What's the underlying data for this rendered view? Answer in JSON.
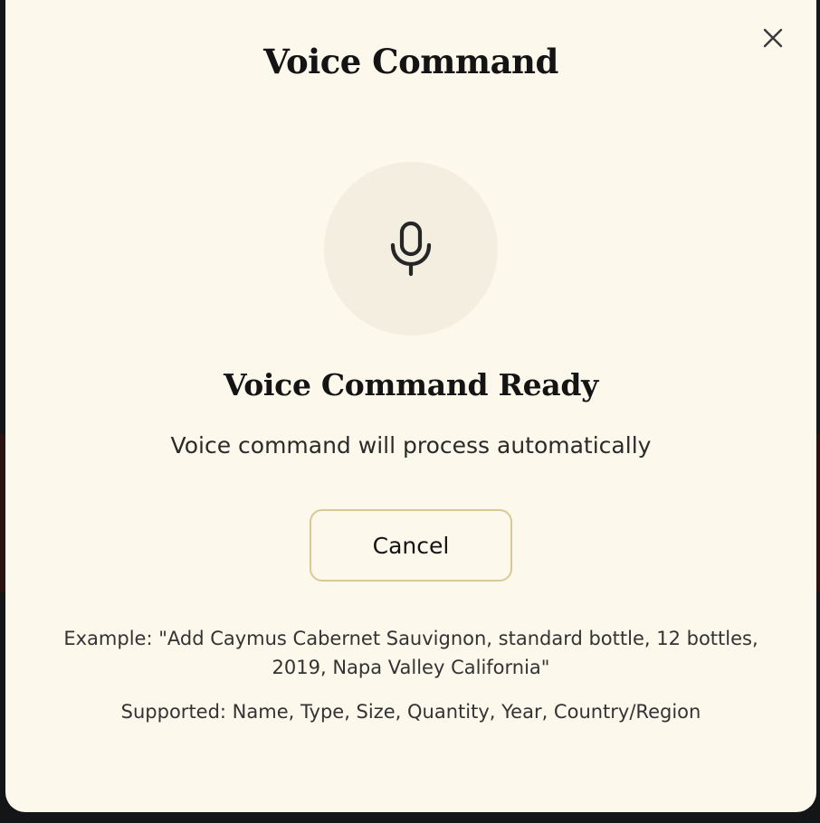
{
  "modal": {
    "title": "Voice Command",
    "close_icon": "close-icon",
    "mic_icon": "microphone-icon",
    "status_title": "Voice Command Ready",
    "status_subtitle": "Voice command will process automatically",
    "cancel_label": "Cancel",
    "example_text": "Example: \"Add Caymus Cabernet Sauvignon, standard bottle, 12 bottles, 2019, Napa Valley California\"",
    "supported_text": "Supported: Name, Type, Size, Quantity, Year, Country/Region"
  },
  "colors": {
    "modal_background": "#fdf8ec",
    "mic_circle": "#f3eee0",
    "button_border": "#d8c995",
    "text": "#141414"
  }
}
